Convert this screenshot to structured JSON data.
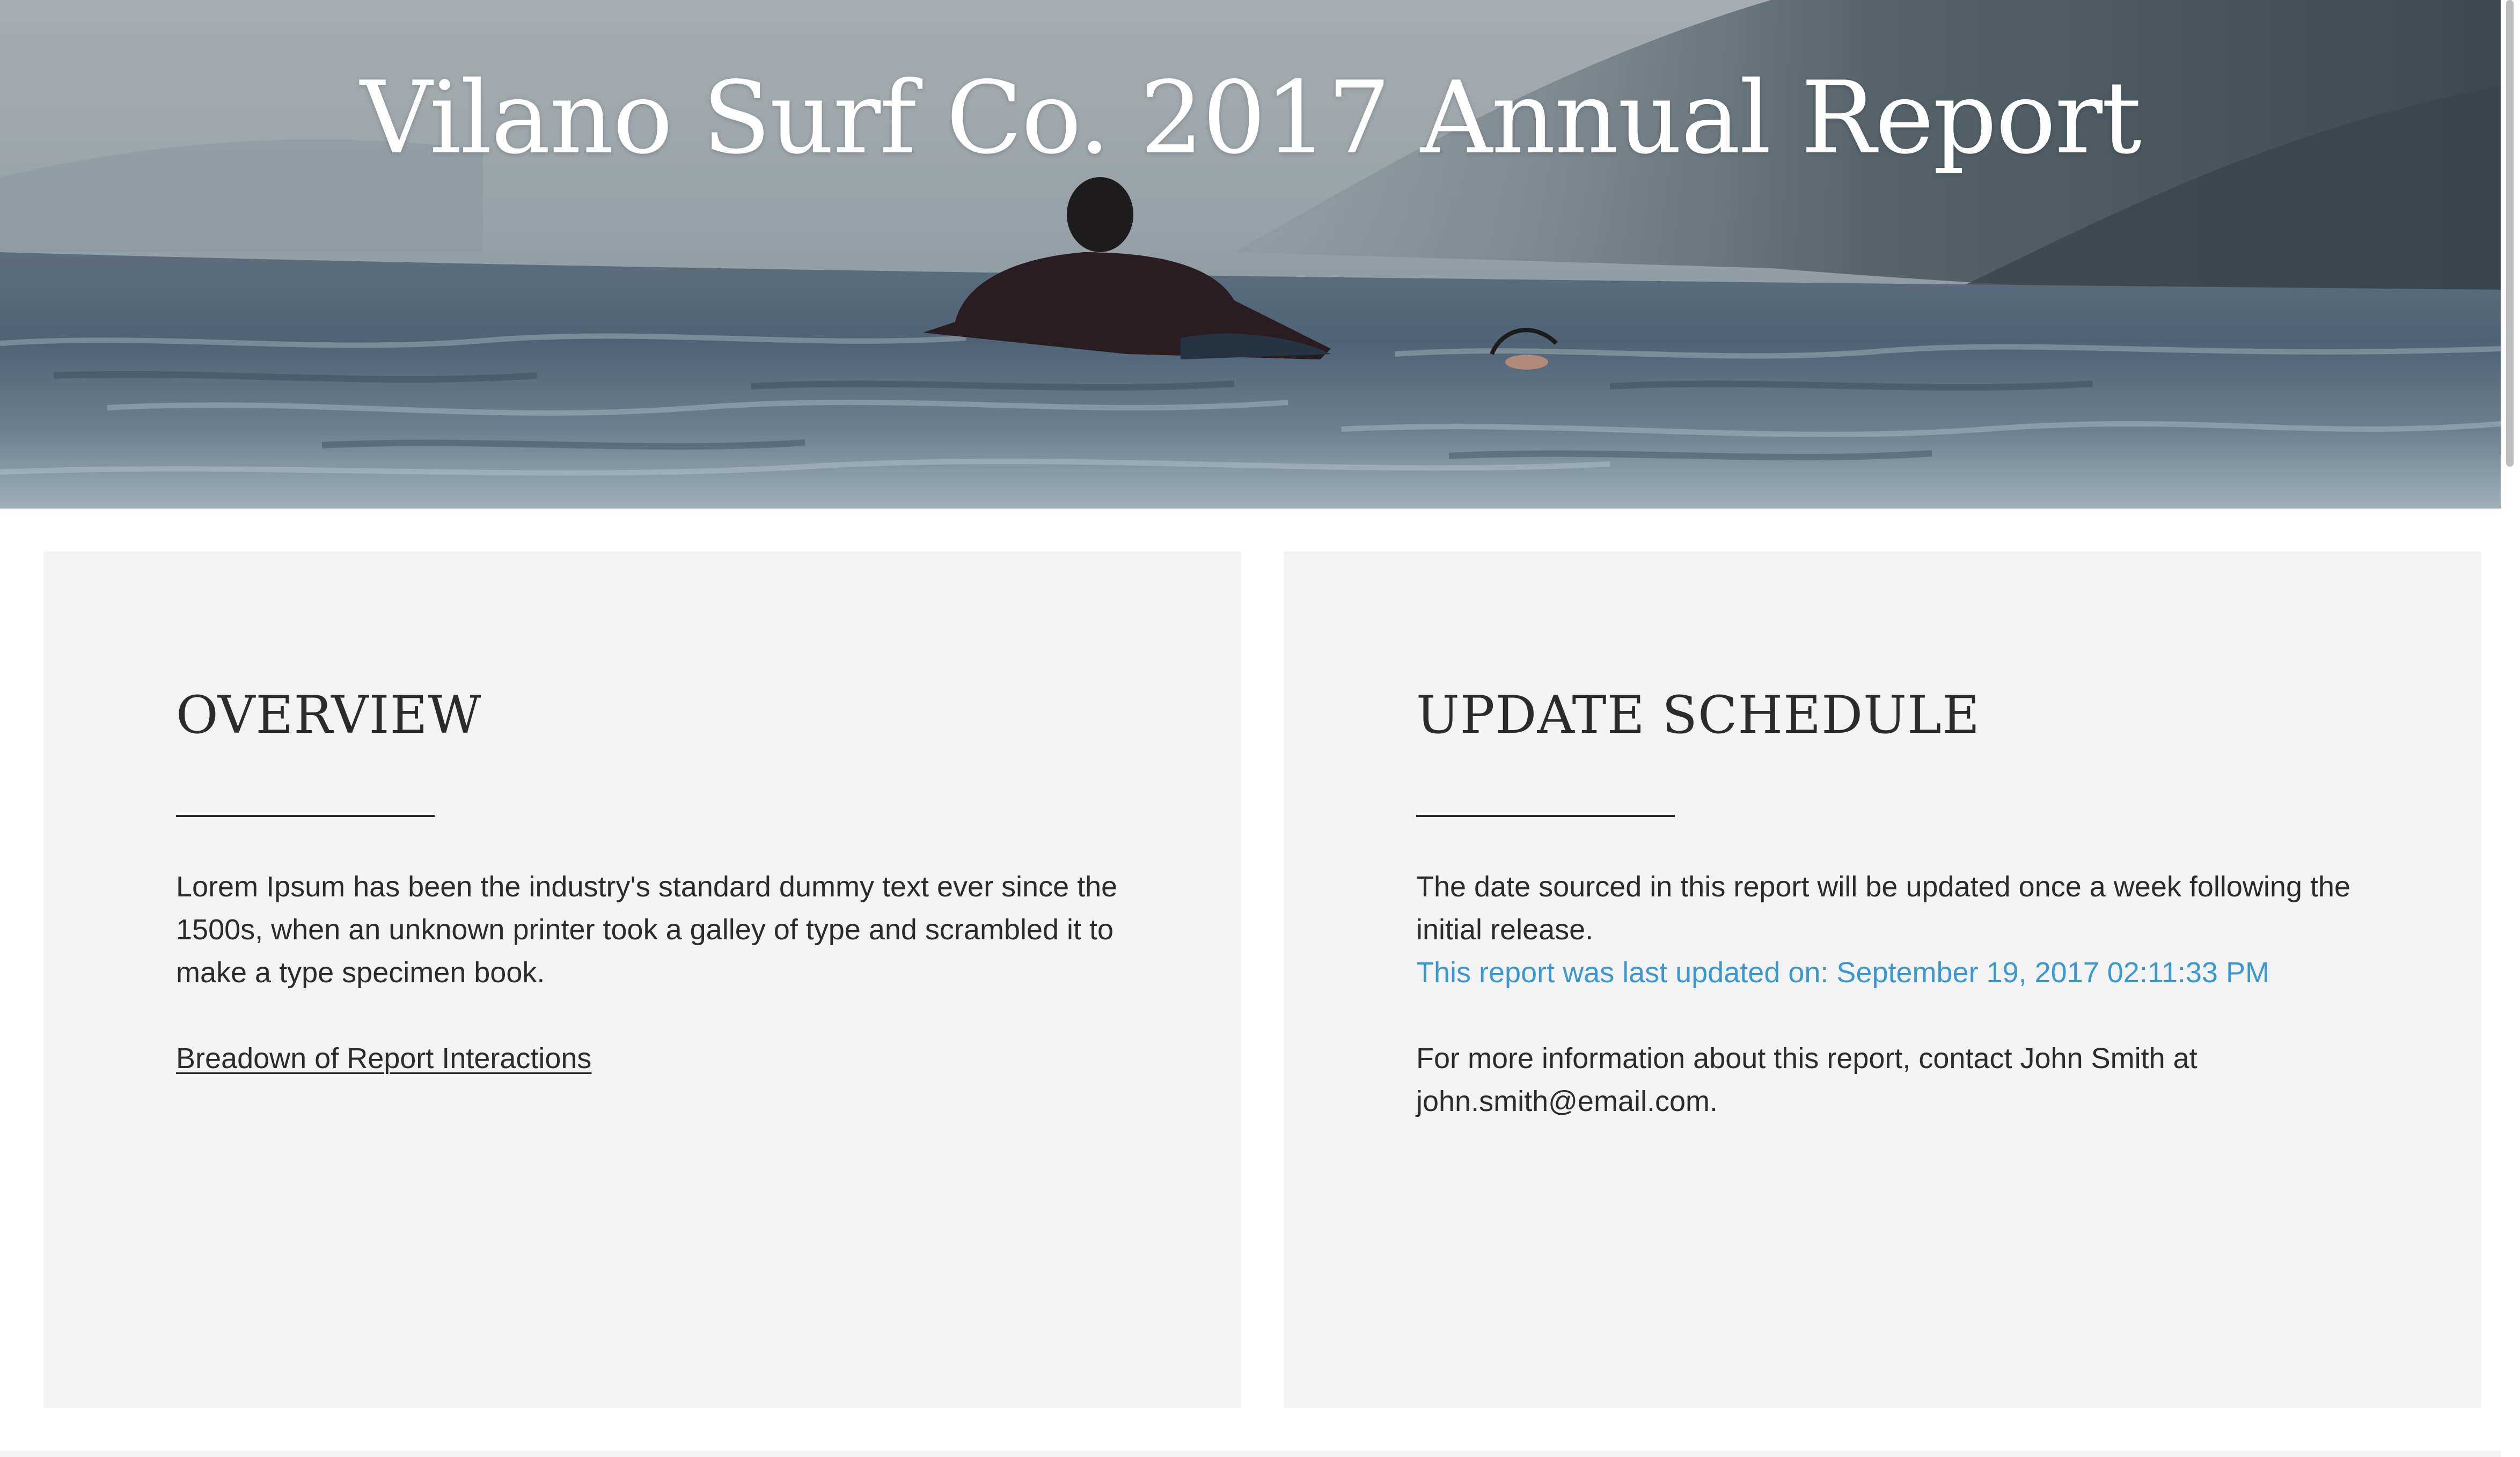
{
  "hero": {
    "title": "Vilano Surf Co. 2017 Annual Report",
    "image": "surfer-paddling-on-ocean"
  },
  "overview": {
    "heading": "OVERVIEW",
    "paragraph": "Lorem Ipsum has been the industry's standard dummy text ever since the 1500s, when an unknown printer took a galley of type and scrambled it to make a type specimen book.",
    "link_label": "Breadown of Report Interactions"
  },
  "update_schedule": {
    "heading": "UPDATE SCHEDULE",
    "paragraph": "The date sourced in this report will be updated once a week following the initial release.",
    "last_updated": "This report was last updated on: September 19, 2017 02:11:33 PM",
    "contact": "For more information about this report, contact John Smith at john.smith@email.com."
  },
  "colors": {
    "card_background": "#f3f3f3",
    "text": "#2b2b2b",
    "accent": "#3a97cf",
    "title": "#ffffff"
  }
}
